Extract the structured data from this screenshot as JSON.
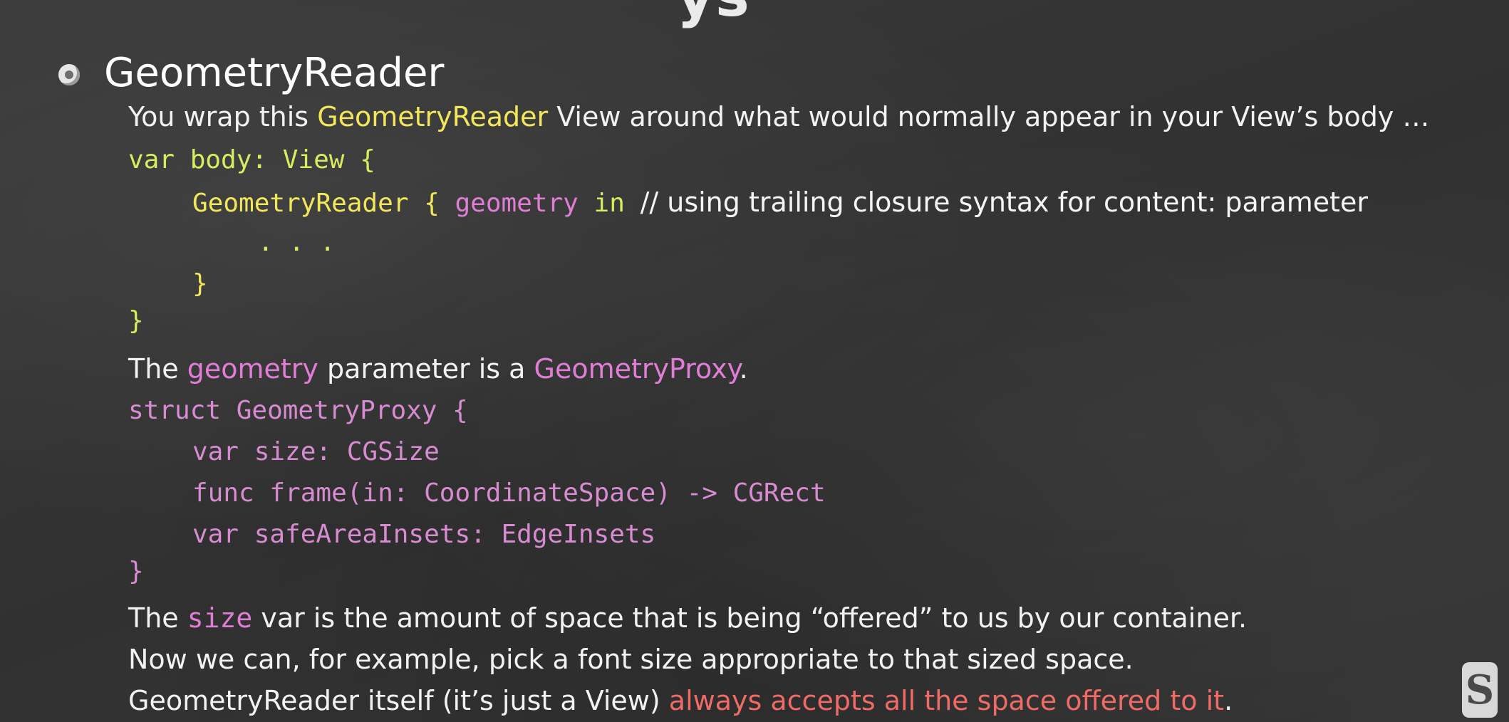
{
  "slide": {
    "title_fragment": "ys",
    "heading": "GeometryReader",
    "intro": {
      "p1": "You wrap this ",
      "p2": "GeometryReader",
      "p3": " View around what would normally appear in your View’s body …"
    },
    "code_body": {
      "l1": "var body: View {",
      "l2a": "GeometryReader { ",
      "l2b": "geometry",
      "l2c": " in ",
      "l2d": "// using trailing closure syntax for content: parameter",
      "l3": ". . .",
      "l4": "}",
      "l5": "}"
    },
    "param": {
      "p1": "The ",
      "p2": "geometry",
      "p3": " parameter is a ",
      "p4": "GeometryProxy",
      "p5": "."
    },
    "code_proxy": {
      "l1": "struct GeometryProxy {",
      "l2": "var size: CGSize",
      "l3": "func frame(in: CoordinateSpace) -> CGRect",
      "l4": "var safeAreaInsets: EdgeInsets",
      "l5": "}"
    },
    "size_line": {
      "p1": "The ",
      "p2": "size",
      "p3": " var is the amount of space that is being “offered” to us by our container."
    },
    "example_line": "Now we can, for example, pick a font size appropriate to that sized space.",
    "accept_line": {
      "p1": "GeometryReader itself (it’s just a View) ",
      "p2": "always accepts all the space offered to it",
      "p3": "."
    },
    "logo_letter": "S"
  }
}
